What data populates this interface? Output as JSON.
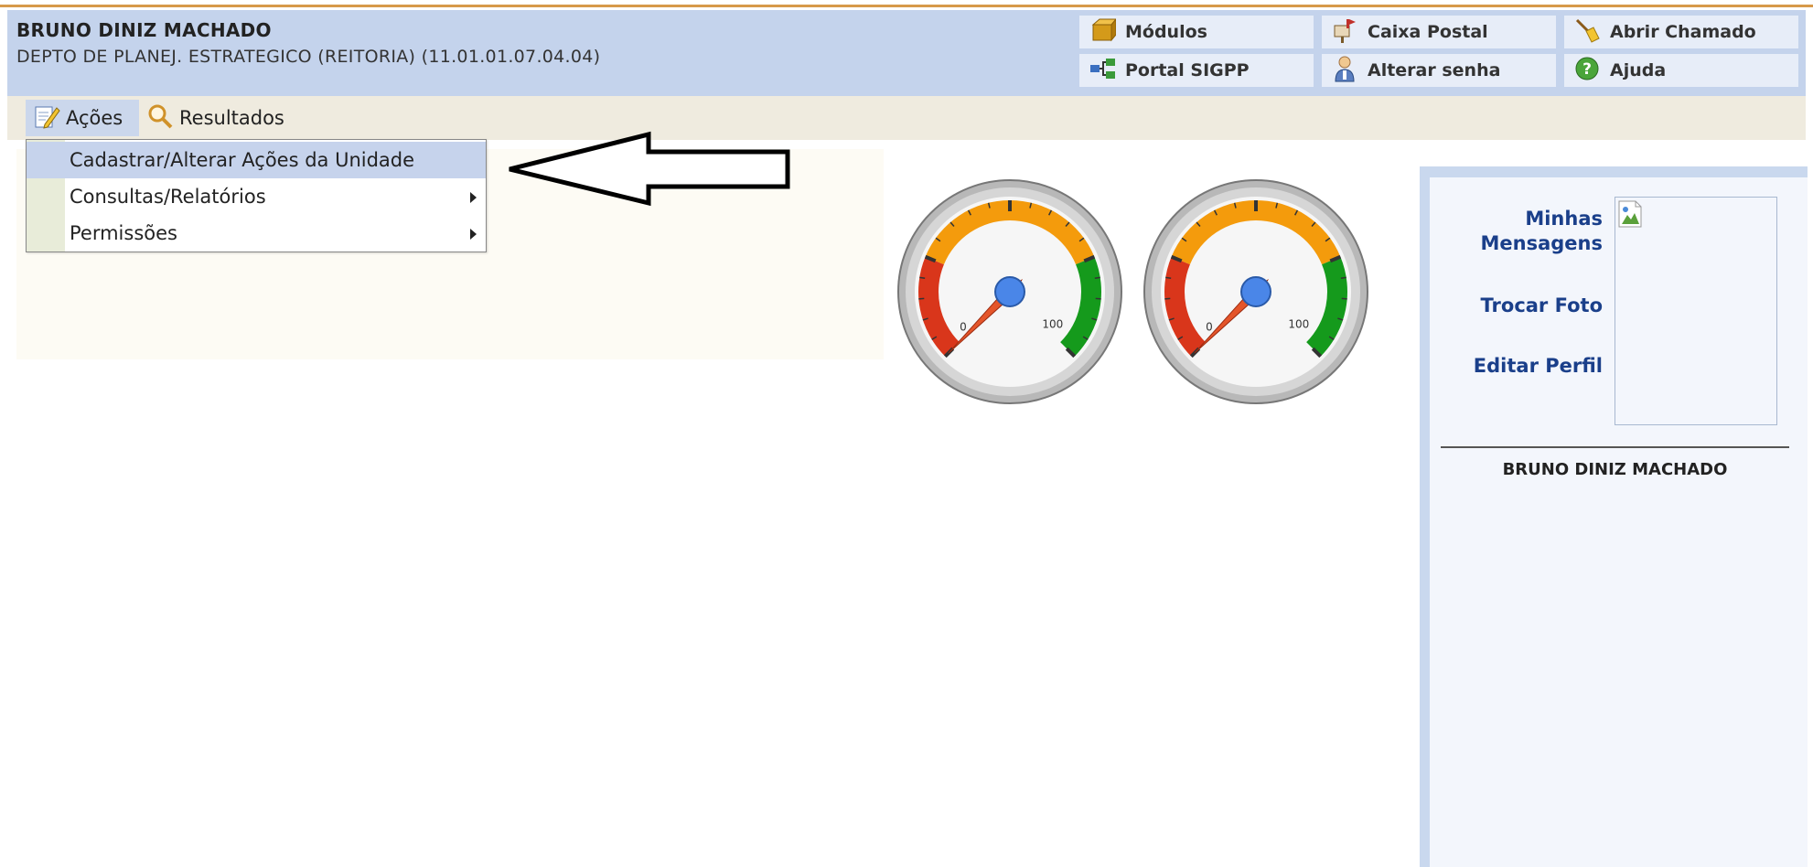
{
  "header": {
    "user_name": "BRUNO DINIZ MACHADO",
    "unit_name": "DEPTO DE PLANEJ. ESTRATEGICO (REITORIA) (11.01.01.07.04.04)",
    "buttons": [
      {
        "label": "Módulos",
        "icon": "modules-box-icon"
      },
      {
        "label": "Caixa Postal",
        "icon": "mailbox-icon"
      },
      {
        "label": "Abrir Chamado",
        "icon": "broom-icon"
      },
      {
        "label": "Portal SIGPP",
        "icon": "network-icon"
      },
      {
        "label": "Alterar senha",
        "icon": "user-key-icon"
      },
      {
        "label": "Ajuda",
        "icon": "help-icon"
      }
    ]
  },
  "menubar": {
    "tabs": [
      {
        "label": "Ações",
        "icon": "edit-notepad-icon",
        "active": true
      },
      {
        "label": "Resultados",
        "icon": "magnifier-icon",
        "active": false
      }
    ]
  },
  "dropdown": {
    "items": [
      {
        "label": "Cadastrar/Alterar Ações da Unidade",
        "highlighted": true,
        "submenu": false
      },
      {
        "label": "Consultas/Relatórios",
        "highlighted": false,
        "submenu": true
      },
      {
        "label": "Permissões",
        "highlighted": false,
        "submenu": true
      }
    ]
  },
  "gauges": [
    {
      "min_label": "0",
      "max_label": "100",
      "value": 0
    },
    {
      "min_label": "0",
      "max_label": "100",
      "value": 0
    }
  ],
  "sidebar": {
    "links": [
      "Minhas Mensagens",
      "Trocar Foto",
      "Editar Perfil"
    ],
    "user_name": "BRUNO DINIZ MACHADO"
  },
  "colors": {
    "header_bg": "#c4d3ec",
    "menubar_bg": "#efebdf",
    "link_blue": "#1a3f8a",
    "gauge_red": "#d9361b",
    "gauge_orange": "#f49b0c",
    "gauge_green": "#159a1c"
  }
}
